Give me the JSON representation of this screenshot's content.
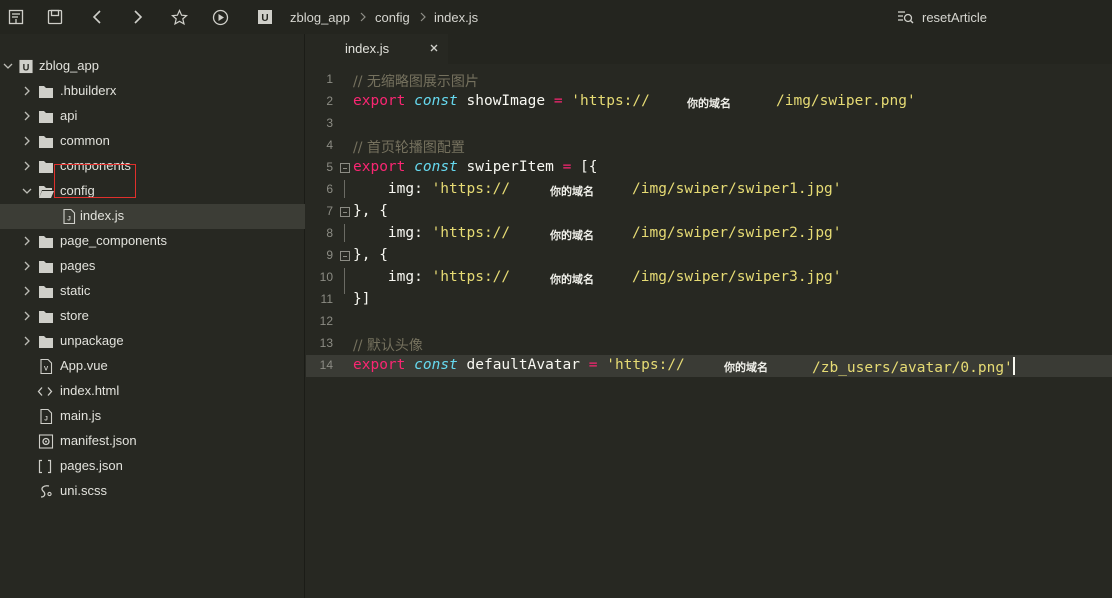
{
  "topbar": {
    "icons": [
      "new-file-icon",
      "save-icon",
      "back-icon",
      "forward-icon",
      "star-icon",
      "run-icon"
    ],
    "breadcrumb": {
      "project": "zblog_app",
      "folder": "config",
      "file": "index.js"
    },
    "search": {
      "icon": "symbol-search-icon",
      "label": "resetArticle"
    }
  },
  "sidebar": {
    "root": "zblog_app",
    "folders": [
      ".hbuilderx",
      "api",
      "common",
      "components",
      "config"
    ],
    "config_child": "index.js",
    "folders2": [
      "page_components",
      "pages",
      "static",
      "store",
      "unpackage"
    ],
    "files": [
      "App.vue",
      "index.html",
      "main.js",
      "manifest.json",
      "pages.json",
      "uni.scss"
    ],
    "highlight_color": "#e0302c"
  },
  "editor": {
    "tab_label": "index.js",
    "line_numbers": [
      "1",
      "2",
      "3",
      "4",
      "5",
      "6",
      "7",
      "8",
      "9",
      "10",
      "11",
      "12",
      "13",
      "14"
    ],
    "l1": "// 无缩略图展示图片",
    "l2": {
      "kw": "export",
      "kw2": "const",
      "name": "showImage",
      "eq": "=",
      "s1": "'https://",
      "domain": "你的域名",
      "s2": "/img/swiper.png'"
    },
    "l4": "// 首页轮播图配置",
    "l5": {
      "kw": "export",
      "kw2": "const",
      "name": "swiperItem",
      "eq": "=",
      "rest": "[{"
    },
    "l6": {
      "key": "img:",
      "s1": "'https://",
      "domain": "你的域名",
      "s2": "/img/swiper/swiper1.jpg'"
    },
    "l7": "}, {",
    "l8": {
      "key": "img:",
      "s1": "'https://",
      "domain": "你的域名",
      "s2": "/img/swiper/swiper2.jpg'"
    },
    "l9": "}, {",
    "l10": {
      "key": "img:",
      "s1": "'https://",
      "domain": "你的域名",
      "s2": "/img/swiper/swiper3.jpg'"
    },
    "l11": "}]",
    "l13": "// 默认头像",
    "l14": {
      "kw": "export",
      "kw2": "const",
      "name": "defaultAvatar",
      "eq": "=",
      "s1": "'https://",
      "domain": "你的域名",
      "s2": "/zb_users/avatar/0.png'"
    },
    "colors": {
      "background": "#272822",
      "keyword": "#f92672",
      "storage": "#66d9ef",
      "string": "#e6db74",
      "comment": "#75715e"
    }
  }
}
